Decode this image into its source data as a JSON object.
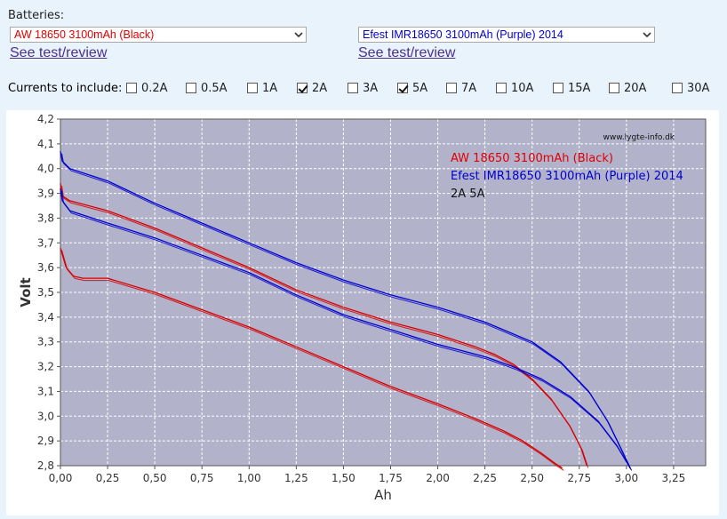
{
  "batteries": {
    "label": "Batteries:",
    "left": {
      "selected": "AW 18650 3100mAh (Black)",
      "color": "#e00000",
      "link": "See test/review"
    },
    "right": {
      "selected": "Efest IMR18650 3100mAh (Purple) 2014",
      "color": "#0000cc",
      "link": "See test/review"
    }
  },
  "currents": {
    "label": "Currents to include:",
    "options": [
      {
        "label": "0.2A",
        "checked": false
      },
      {
        "label": "0.5A",
        "checked": false
      },
      {
        "label": "1A",
        "checked": false
      },
      {
        "label": "2A",
        "checked": true
      },
      {
        "label": "3A",
        "checked": false
      },
      {
        "label": "5A",
        "checked": true
      },
      {
        "label": "7A",
        "checked": false
      },
      {
        "label": "10A",
        "checked": false
      },
      {
        "label": "15A",
        "checked": false
      },
      {
        "label": "20A",
        "checked": false
      },
      {
        "label": "30A",
        "checked": false
      }
    ]
  },
  "chart_data": {
    "type": "line",
    "xlabel": "Ah",
    "ylabel": "Volt",
    "xlim": [
      0,
      3.42
    ],
    "ylim": [
      2.8,
      4.2
    ],
    "x_ticks": [
      "0,00",
      "0,25",
      "0,50",
      "0,75",
      "1,00",
      "1,25",
      "1,50",
      "1,75",
      "2,00",
      "2,25",
      "2,50",
      "2,75",
      "3,00",
      "3,25"
    ],
    "y_ticks": [
      "2,8",
      "2,9",
      "3,0",
      "3,1",
      "3,2",
      "3,3",
      "3,4",
      "3,5",
      "3,6",
      "3,7",
      "3,8",
      "3,9",
      "4,0",
      "4,1",
      "4,2"
    ],
    "grid": true,
    "plot_background": "#b2b2cb",
    "watermark": "www.lygte-info.dk",
    "legend": {
      "placement": "top-right",
      "entries": [
        {
          "text": "AW 18650 3100mAh (Black)",
          "color": "#e00000"
        },
        {
          "text": "Efest IMR18650 3100mAh (Purple) 2014",
          "color": "#0000cc"
        },
        {
          "text": "2A 5A",
          "color": "#111111"
        }
      ]
    },
    "series": [
      {
        "battery": "AW 18650 3100mAh (Black)",
        "current": "2A",
        "color": "#d60000",
        "x": [
          0,
          0.01,
          0.05,
          0.25,
          0.5,
          0.75,
          1.0,
          1.25,
          1.5,
          1.75,
          2.0,
          2.2,
          2.3,
          2.4,
          2.5,
          2.6,
          2.7,
          2.76,
          2.79
        ],
        "y": [
          3.94,
          3.89,
          3.87,
          3.83,
          3.76,
          3.68,
          3.6,
          3.51,
          3.44,
          3.38,
          3.33,
          3.28,
          3.25,
          3.21,
          3.15,
          3.07,
          2.96,
          2.87,
          2.8
        ]
      },
      {
        "battery": "AW 18650 3100mAh (Black)",
        "current": "5A",
        "color": "#d60000",
        "x": [
          0,
          0.03,
          0.07,
          0.12,
          0.25,
          0.5,
          0.75,
          1.0,
          1.25,
          1.5,
          1.75,
          2.0,
          2.2,
          2.35,
          2.45,
          2.55,
          2.62,
          2.66
        ],
        "y": [
          3.68,
          3.6,
          3.565,
          3.557,
          3.557,
          3.5,
          3.43,
          3.36,
          3.28,
          3.2,
          3.12,
          3.05,
          2.99,
          2.94,
          2.9,
          2.85,
          2.81,
          2.79
        ]
      },
      {
        "battery": "Efest IMR18650 3100mAh (Purple) 2014",
        "current": "2A",
        "color": "#0000d0",
        "x": [
          0,
          0.01,
          0.05,
          0.25,
          0.5,
          0.75,
          1.0,
          1.25,
          1.5,
          1.75,
          2.0,
          2.25,
          2.5,
          2.65,
          2.8,
          2.9,
          2.97,
          3.02
        ],
        "y": [
          4.07,
          4.03,
          4.0,
          3.95,
          3.86,
          3.78,
          3.7,
          3.62,
          3.55,
          3.49,
          3.44,
          3.38,
          3.3,
          3.22,
          3.1,
          2.98,
          2.87,
          2.79
        ]
      },
      {
        "battery": "Efest IMR18650 3100mAh (Purple) 2014",
        "current": "5A",
        "color": "#0000d0",
        "x": [
          0,
          0.01,
          0.05,
          0.25,
          0.5,
          0.75,
          1.0,
          1.25,
          1.5,
          1.75,
          2.0,
          2.25,
          2.4,
          2.55,
          2.7,
          2.85,
          2.95,
          3.02
        ],
        "y": [
          3.92,
          3.87,
          3.83,
          3.78,
          3.72,
          3.65,
          3.58,
          3.49,
          3.41,
          3.35,
          3.29,
          3.24,
          3.2,
          3.15,
          3.08,
          2.98,
          2.88,
          2.79
        ]
      }
    ]
  }
}
